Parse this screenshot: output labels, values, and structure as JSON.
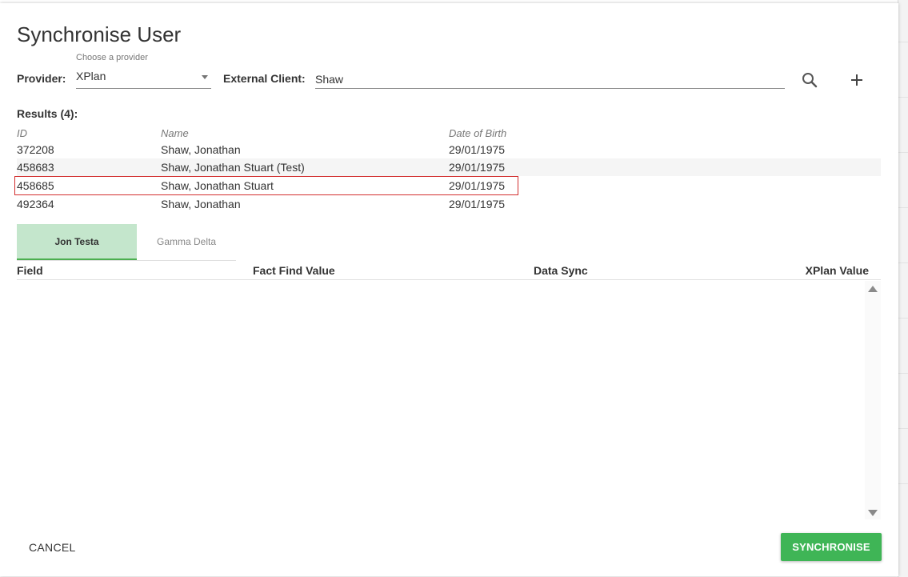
{
  "dialog": {
    "title": "Synchronise User"
  },
  "provider": {
    "label": "Provider:",
    "hint": "Choose a provider",
    "value": "XPlan"
  },
  "external_client": {
    "label": "External Client:",
    "value": "Shaw"
  },
  "icons": {
    "search": "search-icon",
    "add": "plus-icon",
    "dropdown": "caret-down-icon"
  },
  "results": {
    "label": "Results (4):",
    "columns": [
      "ID",
      "Name",
      "Date of Birth"
    ],
    "rows": [
      {
        "id": "372208",
        "name": "Shaw, Jonathan",
        "dob": "29/01/1975"
      },
      {
        "id": "458683",
        "name": "Shaw, Jonathan Stuart (Test)",
        "dob": "29/01/1975"
      },
      {
        "id": "458685",
        "name": "Shaw, Jonathan Stuart",
        "dob": "29/01/1975"
      },
      {
        "id": "492364",
        "name": "Shaw, Jonathan",
        "dob": "29/01/1975"
      }
    ]
  },
  "tabs": [
    {
      "label": "Jon Testa",
      "active": true
    },
    {
      "label": "Gamma Delta",
      "active": false
    }
  ],
  "grid": {
    "columns": [
      "Field",
      "Fact Find Value",
      "Data Sync",
      "XPlan Value"
    ]
  },
  "footer": {
    "cancel_label": "CANCEL",
    "synchronise_label": "SYNCHRONISE"
  },
  "colors": {
    "accent": "#3fb556",
    "tab_active_bg": "#c4e6cc",
    "selected_outline": "#d22e2e"
  }
}
